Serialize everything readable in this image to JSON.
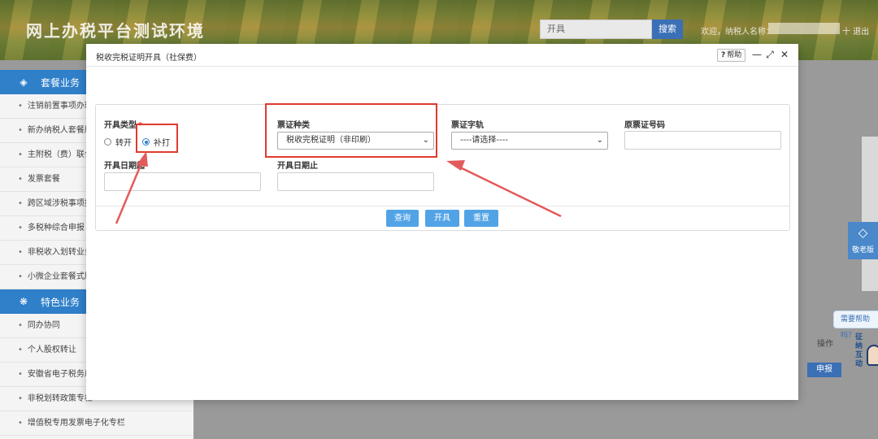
{
  "header": {
    "site_title": "网上办税平台测试环境",
    "search_value": "开具",
    "search_btn": "搜索",
    "welcome": "欢迎，纳税人名称：",
    "logout": "十 退出"
  },
  "sidebar": {
    "groups": [
      {
        "label": "套餐业务",
        "items": [
          "注销前置事项办理",
          "新办纳税人套餐服务",
          "主附税（费）联合申报",
          "发票套餐",
          "跨区域涉税事项报告",
          "多税种综合申报",
          "非税收入划转业务专栏",
          "小微企业套餐式服务"
        ]
      },
      {
        "label": "特色业务",
        "items": [
          "同办协同",
          "个人股权转让",
          "安徽省电子税务局",
          "非税划转政策专栏",
          "增值税专用发票电子化专栏"
        ]
      }
    ]
  },
  "background": {
    "side_widget": "敬老版",
    "help_bubble": "需要帮助吗？",
    "col_operation": "操作",
    "declare_btn": "申报",
    "robot_text": "征纳互动"
  },
  "modal": {
    "title": "税收完税证明开具（社保费）",
    "help": "帮助",
    "form": {
      "issue_type_label": "开具类型",
      "issue_type_options": [
        "转开",
        "补打"
      ],
      "issue_type_selected": "补打",
      "ticket_kind_label": "票证种类",
      "ticket_kind_value": "税收完税证明（非印刷）",
      "ticket_track_label": "票证字轨",
      "ticket_track_value": "----请选择----",
      "orig_ticket_label": "原票证号码",
      "date_from_label": "开具日期起",
      "date_to_label": "开具日期止"
    },
    "buttons": {
      "query": "查询",
      "issue": "开具",
      "reset": "重置"
    }
  },
  "colors": {
    "primary": "#2f7fc9",
    "button": "#52a3e6",
    "highlight": "#e03a2f"
  }
}
